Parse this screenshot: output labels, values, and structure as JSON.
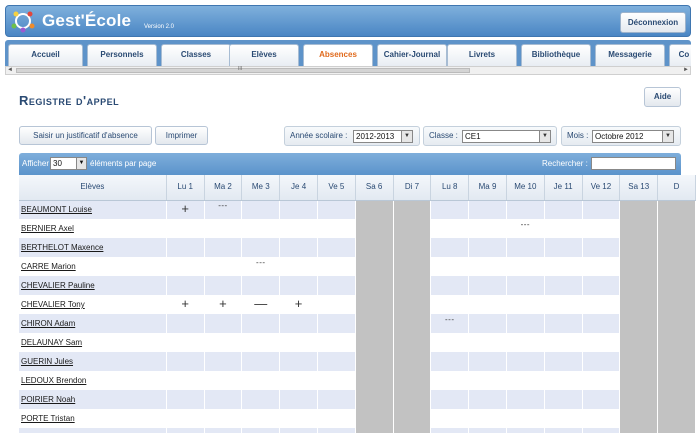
{
  "header": {
    "app_title": "Gest'École",
    "version": "Version 2.0",
    "logout_label": "Déconnexion",
    "accent_color": "#4a86c4"
  },
  "tabs": [
    {
      "label": "Accueil"
    },
    {
      "label": "Personnels"
    },
    {
      "label": "Classes"
    },
    {
      "label": "Elèves"
    },
    {
      "label": "Absences",
      "active": true
    },
    {
      "label": "Cahier-Journal"
    },
    {
      "label": "Livrets"
    },
    {
      "label": "Bibliothèque"
    },
    {
      "label": "Messagerie"
    },
    {
      "label": "Co"
    }
  ],
  "scrollbar": {
    "grip": "III"
  },
  "page": {
    "title": "Registre d'appel",
    "help_label": "Aide"
  },
  "toolbar": {
    "justify_label": "Saisir un justificatif d'absence",
    "print_label": "Imprimer",
    "year_label": "Année scolaire :",
    "year_value": "2012-2013",
    "class_label": "Classe :",
    "class_value": "CE1",
    "month_label": "Mois :",
    "month_value": "Octobre 2012"
  },
  "table_controls": {
    "show_label": "Afficher",
    "page_length": "30",
    "per_page_label": "éléments par page",
    "search_label": "Rechercher :",
    "search_value": ""
  },
  "columns": {
    "students_header": "Elèves",
    "days": [
      {
        "label": "Lu 1",
        "weekend": false
      },
      {
        "label": "Ma 2",
        "weekend": false
      },
      {
        "label": "Me 3",
        "weekend": false
      },
      {
        "label": "Je 4",
        "weekend": false
      },
      {
        "label": "Ve 5",
        "weekend": false
      },
      {
        "label": "Sa 6",
        "weekend": true
      },
      {
        "label": "Di 7",
        "weekend": true
      },
      {
        "label": "Lu 8",
        "weekend": false
      },
      {
        "label": "Ma 9",
        "weekend": false
      },
      {
        "label": "Me 10",
        "weekend": false
      },
      {
        "label": "Je 11",
        "weekend": false
      },
      {
        "label": "Ve 12",
        "weekend": false
      },
      {
        "label": "Sa 13",
        "weekend": true
      },
      {
        "label": "D",
        "weekend": true
      }
    ]
  },
  "students": [
    {
      "name": "BEAUMONT Louise",
      "marks": {
        "0": "+",
        "1": "---"
      }
    },
    {
      "name": "BERNIER Axel",
      "marks": {
        "9": "---"
      }
    },
    {
      "name": "BERTHELOT Maxence",
      "marks": {}
    },
    {
      "name": "CARRE Marion",
      "marks": {
        "2": "---"
      }
    },
    {
      "name": "CHEVALIER Pauline",
      "marks": {}
    },
    {
      "name": "CHEVALIER Tony",
      "marks": {
        "0": "+",
        "1": "+",
        "2": "—",
        "3": "+"
      }
    },
    {
      "name": "CHIRON Adam",
      "marks": {
        "7": "---"
      }
    },
    {
      "name": "DELAUNAY Sam",
      "marks": {}
    },
    {
      "name": "GUERIN Jules",
      "marks": {}
    },
    {
      "name": "LEDOUX Brendon",
      "marks": {}
    },
    {
      "name": "POIRIER Noah",
      "marks": {}
    },
    {
      "name": "PORTE Tristan",
      "marks": {}
    },
    {
      "name": "",
      "marks": {}
    }
  ]
}
